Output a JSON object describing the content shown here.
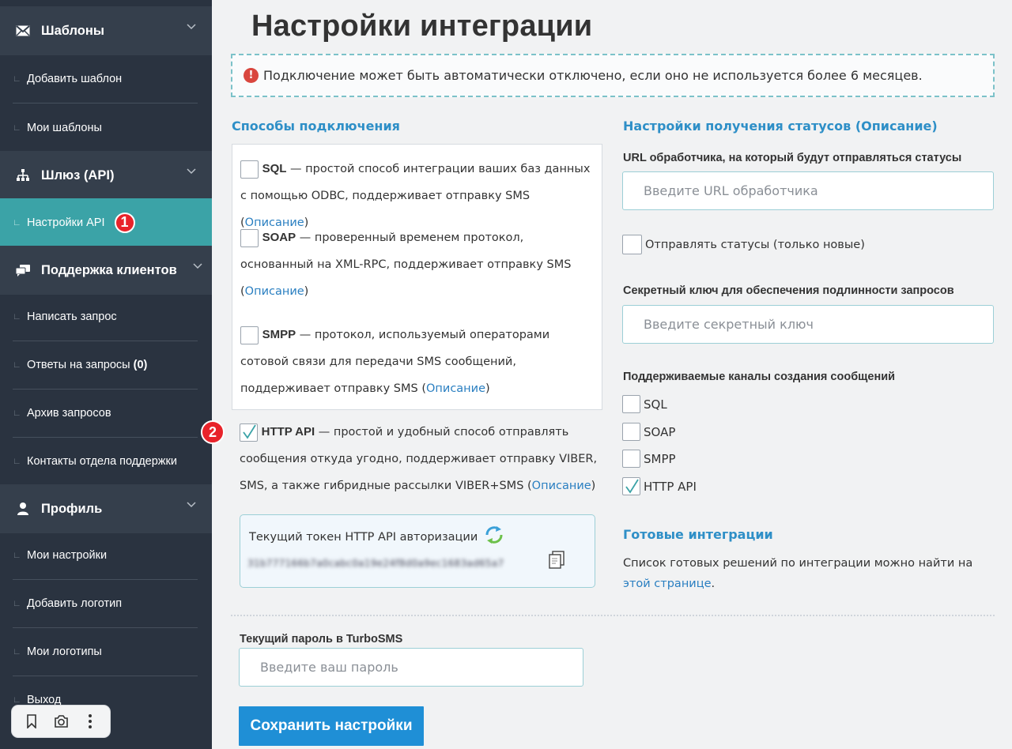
{
  "sidebar": {
    "sections": [
      {
        "id": "templates",
        "label": "Шаблоны",
        "icon": "envelope-icon"
      },
      {
        "id": "gateway",
        "label": "Шлюз (API)",
        "icon": "network-icon"
      },
      {
        "id": "support",
        "label": "Поддержка клиентов",
        "icon": "chat-icon"
      },
      {
        "id": "profile",
        "label": "Профиль",
        "icon": "user-icon"
      }
    ],
    "items": {
      "add_template": "Добавить шаблон",
      "my_templates": "Мои шаблоны",
      "api_settings": "Настройки API",
      "write_request": "Написать запрос",
      "answers": "Ответы на запросы",
      "answers_count": "(0)",
      "archive": "Архив запросов",
      "contacts": "Контакты отдела поддержки",
      "my_settings": "Мои настройки",
      "add_logo": "Добавить логотип",
      "my_logos": "Мои логотипы",
      "logout": "Выход"
    },
    "badge1": "1"
  },
  "page": {
    "title": "Настройки интеграции",
    "notice": "Подключение может быть автоматически отключено, если оно не используется более 6 месяцев."
  },
  "methods": {
    "title": "Способы подключения",
    "sql": {
      "name": "SQL",
      "text": " — простой способ интеграции ваших баз данных с помощью ODBC, поддерживает отправку SMS (",
      "link": "Описание",
      "tail": ")",
      "checked": false
    },
    "soap": {
      "name": "SOAP",
      "text": " — проверенный временем протокол, основанный на XML-RPC, поддерживает отправку SMS (",
      "link": "Описание",
      "tail": ")",
      "checked": false
    },
    "smpp": {
      "name": "SMPP",
      "text": " — протокол, используемый операторами сотовой связи для передачи SMS сообщений, поддерживает отправку SMS (",
      "link": "Описание",
      "tail": ")",
      "checked": false
    },
    "http": {
      "name": "HTTP API",
      "text": " — простой и удобный способ отправлять сообщения откуда угодно, поддерживает отправку VIBER, SMS, а также гибридные рассылки VIBER+SMS (",
      "link": "Описание",
      "tail": ")",
      "checked": true
    },
    "badge2": "2"
  },
  "token": {
    "label": "Текущий токен HTTP API авторизации",
    "value": "31b777166b7a0cabc0a19e24f8d0a9ec1683ad65a7"
  },
  "password": {
    "label": "Текущий пароль в TurboSMS",
    "placeholder": "Введите ваш пароль"
  },
  "save_label": "Сохранить настройки",
  "status": {
    "title": "Настройки получения статусов (Описание)",
    "url_label": "URL обработчика, на который будут отправляться статусы",
    "url_placeholder": "Введите URL обработчика",
    "send_label": "Отправлять статусы (только новые)",
    "secret_label": "Секретный ключ для обеспечения подлинности запросов",
    "secret_placeholder": "Введите секретный ключ",
    "channels_label": "Поддерживаемые каналы создания сообщений",
    "channels": [
      {
        "label": "SQL",
        "checked": false
      },
      {
        "label": "SOAP",
        "checked": false
      },
      {
        "label": "SMPP",
        "checked": false
      },
      {
        "label": "HTTP API",
        "checked": true
      }
    ]
  },
  "ready": {
    "title": "Готовые интеграции",
    "text": "Список готовых решений по интеграции можно найти на ",
    "link": "этой странице",
    "tail": "."
  },
  "colors": {
    "sidebar": "#2a3340",
    "sidebar_head": "#353f4c",
    "active": "#3ba3a7",
    "accent": "#2e8fc7",
    "button": "#1f8fd6",
    "badge": "#e8232a"
  }
}
